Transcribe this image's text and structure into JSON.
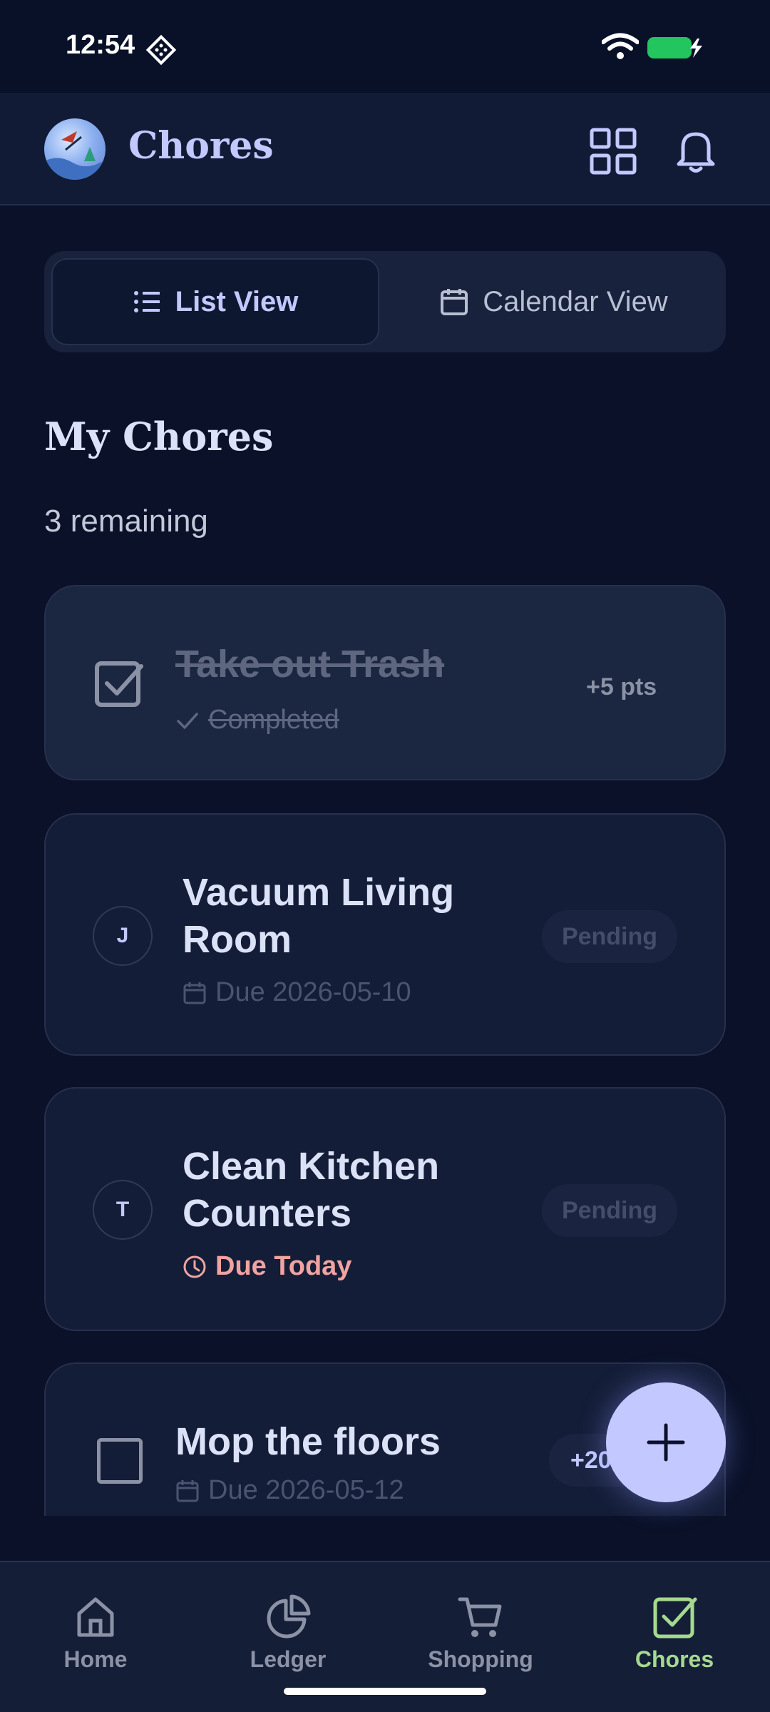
{
  "status_bar": {
    "time": "12:54"
  },
  "header": {
    "title": "Chores"
  },
  "view_toggle": {
    "list_label": "List View",
    "calendar_label": "Calendar View",
    "selected": "List View"
  },
  "section": {
    "title": "My Chores",
    "remaining": "3 remaining"
  },
  "chores": [
    {
      "title": "Take out Trash",
      "meta": "Completed",
      "points": "+5 pts",
      "state": "completed"
    },
    {
      "title_line1": "Vacuum Living",
      "title_line2": "Room",
      "assignee_initial": "J",
      "meta": "Due 2026-05-10",
      "status": "Pending"
    },
    {
      "title_line1": "Clean Kitchen",
      "title_line2": "Counters",
      "assignee_initial": "T",
      "meta": "Due Today",
      "status": "Pending"
    },
    {
      "title": "Mop the floors",
      "meta": "Due 2026-05-12",
      "points": "+20"
    }
  ],
  "bottom_nav": {
    "items": [
      {
        "label": "Home",
        "icon": "home-icon"
      },
      {
        "label": "Ledger",
        "icon": "pie-chart-icon"
      },
      {
        "label": "Shopping",
        "icon": "cart-icon"
      },
      {
        "label": "Chores",
        "icon": "checkbox-icon"
      }
    ],
    "active": "Chores"
  },
  "colors": {
    "background": "#0a1128",
    "accent": "#c3c8ff",
    "active_nav": "#a6d98f",
    "due_today": "#f0a3a0"
  }
}
